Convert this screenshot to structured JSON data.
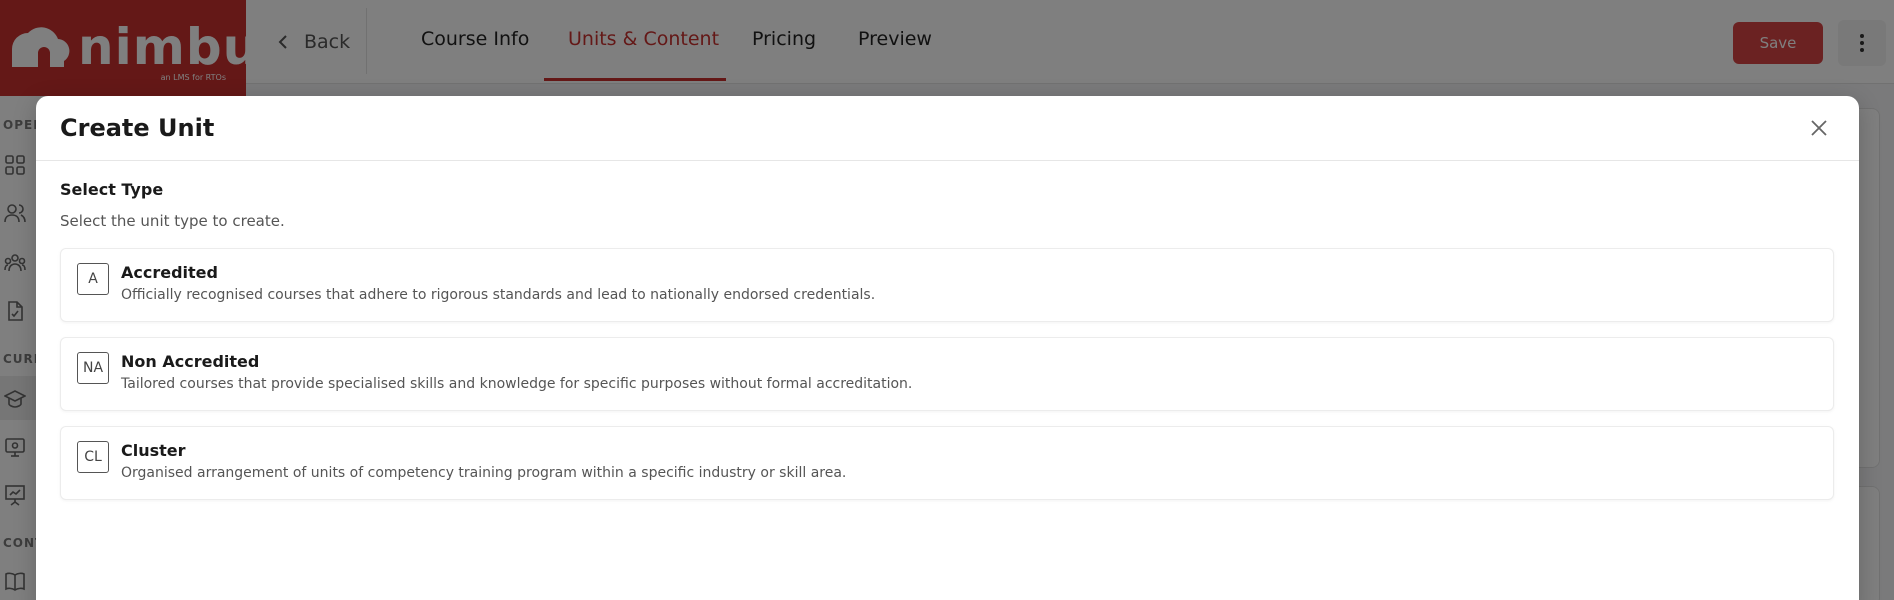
{
  "app": {
    "logo_text": "nimbu",
    "logo_tagline": "an LMS for RTOs",
    "sidebar_sections": [
      "OPER",
      "CURR",
      "CONT"
    ]
  },
  "topbar": {
    "back_label": "Back",
    "tabs": [
      {
        "label": "Course Info"
      },
      {
        "label": "Units & Content"
      },
      {
        "label": "Pricing"
      },
      {
        "label": "Preview"
      }
    ],
    "active_tab": "Units & Content",
    "save_label": "Save"
  },
  "modal": {
    "title": "Create Unit",
    "section_title": "Select Type",
    "section_subtitle": "Select the unit type to create.",
    "options": [
      {
        "badge": "A",
        "title": "Accredited",
        "description": "Officially recognised courses that adhere to rigorous standards and lead to nationally endorsed credentials."
      },
      {
        "badge": "NA",
        "title": "Non Accredited",
        "description": "Tailored courses that provide specialised skills and knowledge for specific purposes without formal accreditation."
      },
      {
        "badge": "CL",
        "title": "Cluster",
        "description": "Organised arrangement of units of competency training program within a specific industry or skill area."
      }
    ]
  },
  "colors": {
    "brand": "#c8312f",
    "save_button": "#d64545",
    "overlay": "rgba(0,0,0,0.5)"
  },
  "icons": [
    "grid-icon",
    "users-icon",
    "team-icon",
    "file-check-icon",
    "graduation-cap-icon",
    "monitor-icon",
    "presentation-icon",
    "book-icon",
    "chevron-left-icon",
    "more-vertical-icon",
    "close-icon"
  ]
}
